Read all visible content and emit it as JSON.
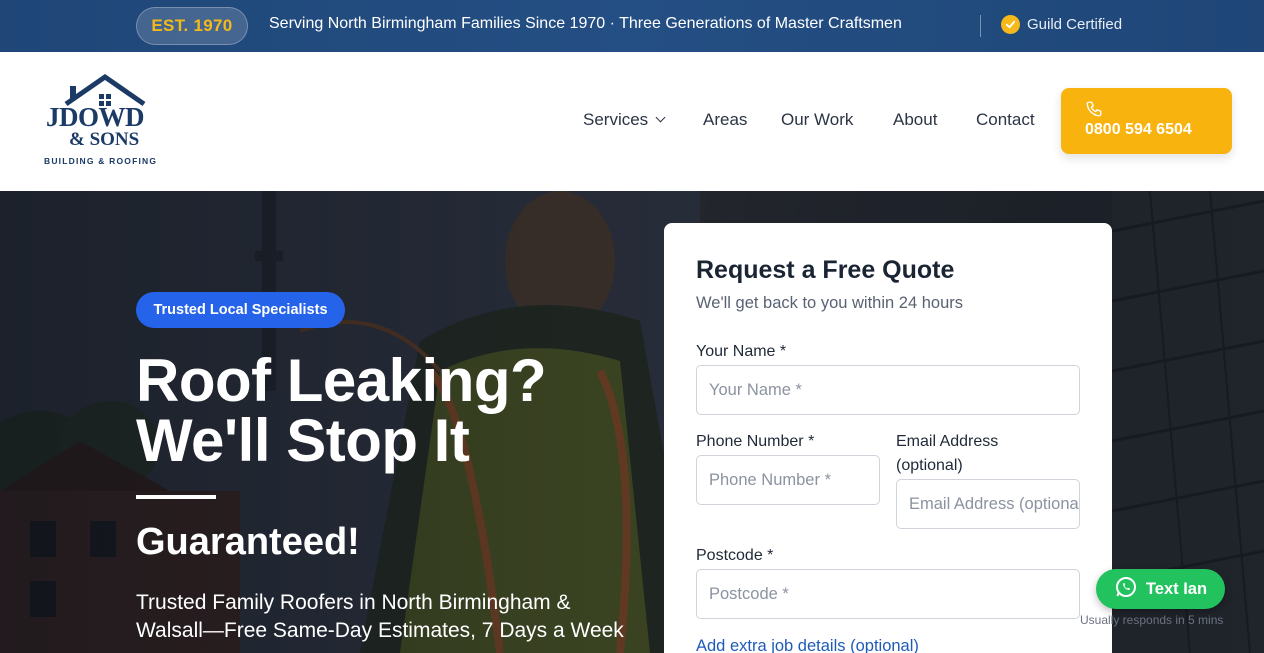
{
  "topbar": {
    "badge": "EST. 1970",
    "tagline": "Serving North Birmingham Families Since 1970 · Three Generations of Master Craftsmen",
    "certified": "Guild Certified",
    "colors": {
      "background": "#1f4677",
      "accent": "#f5b91a"
    }
  },
  "logo": {
    "main": "JDOWD",
    "sons": "& SONS",
    "sub": "BUILDING & ROOFING"
  },
  "nav": {
    "items": [
      "Services",
      "Areas",
      "Our Work",
      "About",
      "Contact"
    ],
    "phone": "0800 594 6504",
    "phone_icon": "phone-icon",
    "phone_color": "#f8b30f"
  },
  "hero": {
    "badge": "Trusted Local Specialists",
    "title_line1": "Roof Leaking?",
    "title_line2": "We'll Stop It",
    "guaranteed": "Guaranteed!",
    "subtitle": "Trusted Family Roofers in North Birmingham & Walsall—Free Same-Day Estimates, 7 Days a Week",
    "badge_color": "#2563eb"
  },
  "quote": {
    "title": "Request a Free Quote",
    "subtitle": "We'll get back to you within 24 hours",
    "name_label": "Your Name *",
    "name_placeholder": "Your Name *",
    "phone_label": "Phone Number *",
    "phone_placeholder": "Phone Number *",
    "email_label": "Email Address (optional)",
    "email_placeholder": "Email Address (optional)",
    "postcode_label": "Postcode *",
    "postcode_placeholder": "Postcode *",
    "extra_link": "Add extra job details (optional)"
  },
  "chat": {
    "button": "Text Ian",
    "note": "Usually responds in 5 mins",
    "icon": "whatsapp-icon",
    "color": "#22c35e"
  }
}
